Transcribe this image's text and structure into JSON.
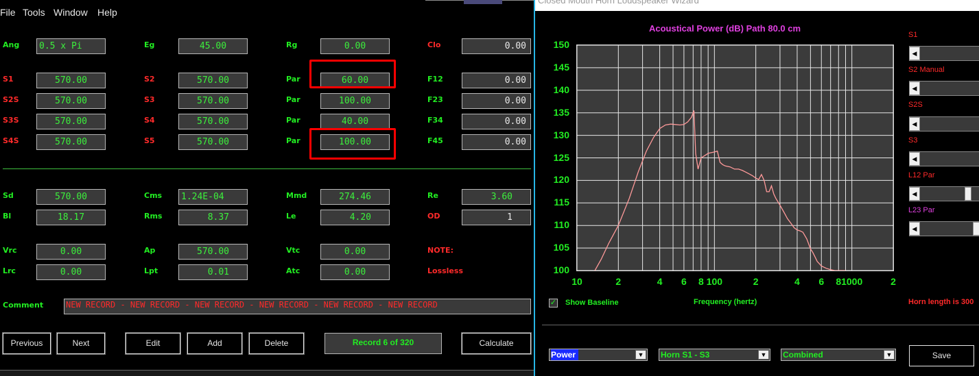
{
  "menu": [
    "File",
    "Tools",
    "Window",
    "Help"
  ],
  "fields": {
    "Ang": "0.5 x Pi",
    "Eg": "45.00",
    "Rg": "0.00",
    "Clo": "0.00",
    "S1": "570.00",
    "S2": "570.00",
    "Par1": "60.00",
    "F12": "0.00",
    "S2S": "570.00",
    "S3": "570.00",
    "Par2": "100.00",
    "F23": "0.00",
    "S3S": "570.00",
    "S4": "570.00",
    "Par3": "40.00",
    "F34": "0.00",
    "S4S": "570.00",
    "S5": "570.00",
    "Par4": "100.00",
    "F45": "0.00",
    "Sd": "570.00",
    "Cms": "1.24E-04",
    "Mmd": "274.46",
    "Re": "3.60",
    "Bl": "18.17",
    "Rms": "8.37",
    "Le": "4.20",
    "OD": "1",
    "Vrc": "0.00",
    "Ap": "570.00",
    "Vtc": "0.00",
    "Lrc": "0.00",
    "Lpt": "0.01",
    "Atc": "0.00"
  },
  "labels": {
    "Ang": "Ang",
    "Eg": "Eg",
    "Rg": "Rg",
    "Clo": "Clo",
    "S1": "S1",
    "S2": "S2",
    "Par": "Par",
    "F12": "F12",
    "S2S": "S2S",
    "S3": "S3",
    "F23": "F23",
    "S3S": "S3S",
    "S4": "S4",
    "F34": "F34",
    "S4S": "S4S",
    "S5": "S5",
    "F45": "F45",
    "Sd": "Sd",
    "Cms": "Cms",
    "Mmd": "Mmd",
    "Re": "Re",
    "Bl": "Bl",
    "Rms": "Rms",
    "Le": "Le",
    "OD": "OD",
    "Vrc": "Vrc",
    "Ap": "Ap",
    "Vtc": "Vtc",
    "NOTE": "NOTE:",
    "Lrc": "Lrc",
    "Lpt": "Lpt",
    "Atc": "Atc",
    "Lossless": "Lossless",
    "Comment": "Comment"
  },
  "comment": "NEW RECORD - NEW RECORD - NEW RECORD - NEW RECORD - NEW RECORD - NEW RECORD",
  "buttons": {
    "previous": "Previous",
    "next": "Next",
    "edit": "Edit",
    "add": "Add",
    "delete": "Delete",
    "calculate": "Calculate"
  },
  "record_status": "Record 6 of 320",
  "right_window": {
    "title": "Closed Mouth Horn Loudspeaker Wizard",
    "show_baseline": "Show Baseline",
    "x_axis_label": "Frequency (hertz)",
    "horn_length": "Horn length is 300",
    "sliders": [
      "S1",
      "S2 Manual",
      "S2S",
      "S3",
      "L12 Par",
      "L23 Par"
    ],
    "combos": {
      "type": "Power",
      "range": "Horn S1 - S3",
      "mode": "Combined"
    },
    "save": "Save"
  },
  "chart_data": {
    "type": "line",
    "title": "Acoustical Power (dB)   Path 80.0 cm",
    "xlabel": "Frequency (hertz)",
    "ylabel": "",
    "x_scale": "log",
    "xlim": [
      10,
      2000
    ],
    "ylim": [
      100,
      150
    ],
    "yticks": [
      100,
      105,
      110,
      115,
      120,
      125,
      130,
      135,
      140,
      145,
      150
    ],
    "xtick_labels": [
      "10",
      "2",
      "4",
      "6",
      "8",
      "100",
      "2",
      "4",
      "6",
      "8",
      "1000",
      "2"
    ],
    "grid": true,
    "series": [
      {
        "color": "#ff9a9a",
        "x": [
          13.5,
          15,
          17,
          20,
          24,
          28,
          32,
          36,
          40,
          44,
          48,
          52,
          56,
          60,
          64,
          68,
          71,
          73,
          76,
          80,
          85,
          90,
          100,
          105,
          110,
          115,
          120,
          130,
          140,
          150,
          160,
          170,
          180,
          190,
          200,
          210,
          220,
          230,
          240,
          250,
          260,
          270,
          280,
          300,
          320,
          340,
          360,
          380,
          400,
          420,
          440,
          470,
          500,
          520,
          540,
          560,
          580,
          600,
          650,
          700,
          750,
          800,
          900
        ],
        "y": [
          100,
          102.5,
          106,
          110,
          116,
          122,
          126.5,
          129.5,
          131.5,
          132.3,
          132.5,
          132.4,
          132.3,
          132.4,
          133,
          134,
          135.5,
          126,
          122.5,
          125,
          125.5,
          126,
          126.3,
          126.5,
          124,
          123.5,
          123.2,
          123,
          122.5,
          122.5,
          122.2,
          121.8,
          121.4,
          121,
          120.5,
          120.2,
          121.3,
          120,
          117.5,
          117.5,
          118.8,
          117,
          116,
          114.5,
          113,
          111.5,
          110.5,
          109.5,
          109,
          108.8,
          108.5,
          107,
          104.8,
          104,
          103,
          102,
          101.5,
          101,
          100.5,
          100.2,
          100,
          100,
          100
        ]
      }
    ]
  }
}
